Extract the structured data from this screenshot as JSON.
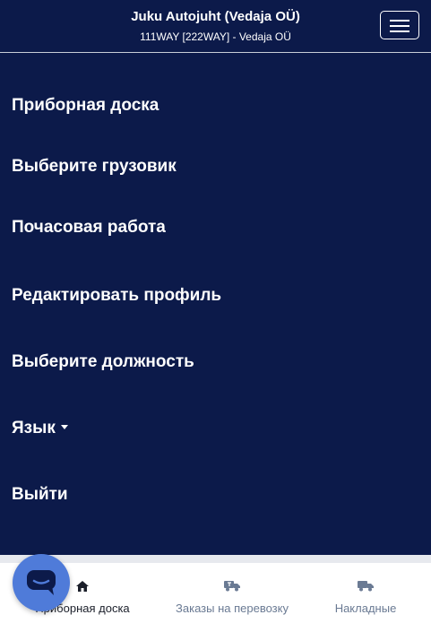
{
  "header": {
    "title": "Juku Autojuht (Vedaja OÜ)",
    "subtitle": "111WAY [222WAY] - Vedaja OÜ",
    "menu_toggle_icon": "hamburger-icon"
  },
  "menu": {
    "items": [
      {
        "label": "Приборная доска"
      },
      {
        "label": "Выберите грузовик"
      },
      {
        "label": "Почасовая работа"
      },
      {
        "label": "Редактировать профиль"
      },
      {
        "label": "Выберите должность"
      },
      {
        "label": "Язык",
        "has_dropdown": true
      },
      {
        "label": "Выйти"
      }
    ]
  },
  "bottom_nav": {
    "items": [
      {
        "label": "Приборная доска",
        "icon": "home-icon",
        "active": true
      },
      {
        "label": "Заказы на перевозку",
        "icon": "truck-icon",
        "active": false
      },
      {
        "label": "Накладные",
        "icon": "truck-icon",
        "active": false
      }
    ]
  },
  "chat": {
    "icon": "chat-icon"
  },
  "colors": {
    "navy": "#0c1a4a",
    "white": "#ffffff",
    "chat_blue": "#4f7bd9",
    "nav_inactive": "#6a7a93"
  }
}
